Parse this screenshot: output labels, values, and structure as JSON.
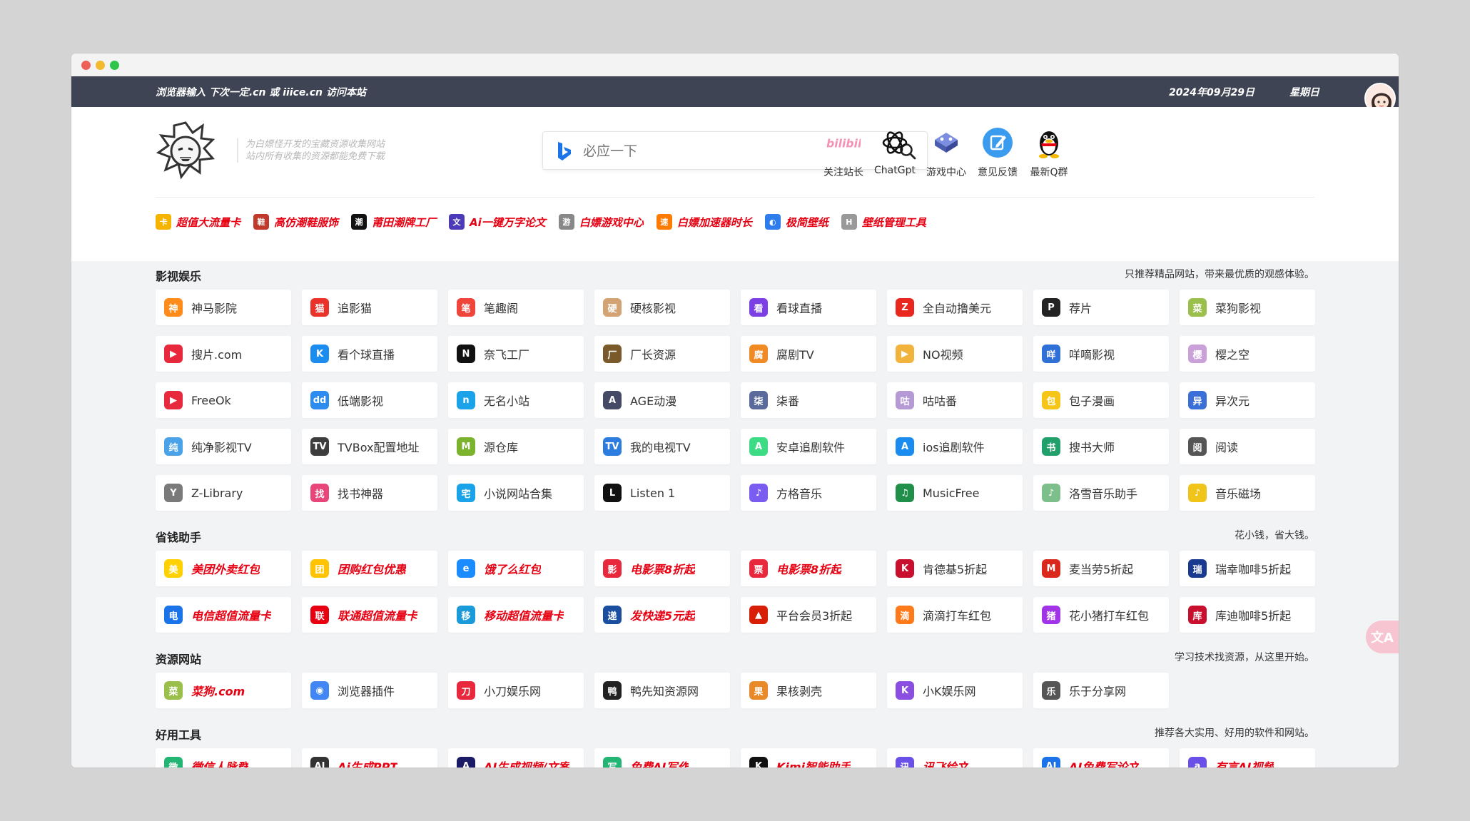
{
  "topbar": {
    "notice": "浏览器输入 下次一定.cn 或 iiice.cn 访问本站",
    "date": "2024年09月29日",
    "weekday": "星期日"
  },
  "header": {
    "slogan_line1": "为白嫖怪开发的宝藏资源收集网站",
    "slogan_line2": "站内所有收集的资源都能免费下载",
    "search_placeholder": "必应一下",
    "quick_links": [
      {
        "label": "关注站长",
        "icon": "bilibili-icon",
        "color": "#f492b5"
      },
      {
        "label": "ChatGpt",
        "icon": "openai-icon",
        "color": "#111111"
      },
      {
        "label": "游戏中心",
        "icon": "gamepad-icon",
        "color": "#5b6cb8"
      },
      {
        "label": "意见反馈",
        "icon": "feedback-icon",
        "color": "#3b9bef"
      },
      {
        "label": "最新Q群",
        "icon": "qq-penguin-icon",
        "color": "#111111"
      }
    ]
  },
  "ads": [
    {
      "label": "超值大流量卡",
      "color": "#f4b400",
      "glyph": "卡"
    },
    {
      "label": "高仿潮鞋服饰",
      "color": "#c0392b",
      "glyph": "鞋"
    },
    {
      "label": "莆田潮牌工厂",
      "color": "#111111",
      "glyph": "潮"
    },
    {
      "label": "Ai一键万字论文",
      "color": "#4b3bb8",
      "glyph": "文"
    },
    {
      "label": "白嫖游戏中心",
      "color": "#888888",
      "glyph": "游"
    },
    {
      "label": "白嫖加速器时长",
      "color": "#ff7a00",
      "glyph": "速"
    },
    {
      "label": "极简壁纸",
      "color": "#2f7ded",
      "glyph": "◐"
    },
    {
      "label": "壁纸管理工具",
      "color": "#999999",
      "glyph": "H"
    }
  ],
  "sections": [
    {
      "title": "影视娱乐",
      "desc": "只推荐精品网站，带来最优质的观感体验。",
      "items": [
        {
          "label": "神马影院",
          "color": "#ff8c1a",
          "glyph": "神"
        },
        {
          "label": "追影猫",
          "color": "#e8322a",
          "glyph": "猫"
        },
        {
          "label": "笔趣阁",
          "color": "#f0453a",
          "glyph": "笔"
        },
        {
          "label": "硬核影视",
          "color": "#d4a373",
          "glyph": "硬"
        },
        {
          "label": "看球直播",
          "color": "#7b3fe4",
          "glyph": "看"
        },
        {
          "label": "全自动撸美元",
          "color": "#e8281e",
          "glyph": "Z"
        },
        {
          "label": "荐片",
          "color": "#222222",
          "glyph": "P"
        },
        {
          "label": "菜狗影视",
          "color": "#9abf4a",
          "glyph": "菜"
        },
        {
          "label": "搜片.com",
          "color": "#e8283c",
          "glyph": "▶"
        },
        {
          "label": "看个球直播",
          "color": "#1b8cf0",
          "glyph": "K"
        },
        {
          "label": "奈飞工厂",
          "color": "#111111",
          "glyph": "N"
        },
        {
          "label": "厂长资源",
          "color": "#7a5a2a",
          "glyph": "厂"
        },
        {
          "label": "腐剧TV",
          "color": "#f08a24",
          "glyph": "腐"
        },
        {
          "label": "NO视频",
          "color": "#f2b33d",
          "glyph": "▶"
        },
        {
          "label": "咩嘀影视",
          "color": "#2e6fd8",
          "glyph": "咩"
        },
        {
          "label": "樱之空",
          "color": "#c9a0d8",
          "glyph": "樱"
        },
        {
          "label": "FreeOk",
          "color": "#e8283c",
          "glyph": "▶"
        },
        {
          "label": "低端影视",
          "color": "#2d8cf0",
          "glyph": "dd"
        },
        {
          "label": "无名小站",
          "color": "#1aa3e8",
          "glyph": "n"
        },
        {
          "label": "AGE动漫",
          "color": "#444a66",
          "glyph": "A"
        },
        {
          "label": "柒番",
          "color": "#5a6a9a",
          "glyph": "柒"
        },
        {
          "label": "咕咕番",
          "color": "#b59ad6",
          "glyph": "咕"
        },
        {
          "label": "包子漫画",
          "color": "#f5c518",
          "glyph": "包"
        },
        {
          "label": "异次元",
          "color": "#3a6fd8",
          "glyph": "异"
        },
        {
          "label": "纯净影视TV",
          "color": "#4aa3e8",
          "glyph": "纯"
        },
        {
          "label": "TVBox配置地址",
          "color": "#3d3d3d",
          "glyph": "TV"
        },
        {
          "label": "源仓库",
          "color": "#7bb32e",
          "glyph": "M"
        },
        {
          "label": "我的电视TV",
          "color": "#2d7de0",
          "glyph": "TV"
        },
        {
          "label": "安卓追剧软件",
          "color": "#3ddc84",
          "glyph": "A"
        },
        {
          "label": "ios追剧软件",
          "color": "#1a8cf0",
          "glyph": "A"
        },
        {
          "label": "搜书大师",
          "color": "#22a06b",
          "glyph": "书"
        },
        {
          "label": "阅读",
          "color": "#555555",
          "glyph": "阅"
        },
        {
          "label": "Z-Library",
          "color": "#7a7a7a",
          "glyph": "Y"
        },
        {
          "label": "找书神器",
          "color": "#e8457a",
          "glyph": "找"
        },
        {
          "label": "小说网站合集",
          "color": "#1aa3e8",
          "glyph": "宅"
        },
        {
          "label": "Listen 1",
          "color": "#111111",
          "glyph": "L"
        },
        {
          "label": "方格音乐",
          "color": "#7b5cf0",
          "glyph": "♪"
        },
        {
          "label": "MusicFree",
          "color": "#1f8f4a",
          "glyph": "♫"
        },
        {
          "label": "洛雪音乐助手",
          "color": "#7dbf8a",
          "glyph": "♪"
        },
        {
          "label": "音乐磁场",
          "color": "#f0c418",
          "glyph": "♪"
        }
      ]
    },
    {
      "title": "省钱助手",
      "desc": "花小钱，省大钱。",
      "items": [
        {
          "label": "美团外卖红包",
          "color": "#ffd100",
          "glyph": "美",
          "red": true
        },
        {
          "label": "团购红包优惠",
          "color": "#ffc300",
          "glyph": "团",
          "red": true
        },
        {
          "label": "饿了么红包",
          "color": "#1a8cff",
          "glyph": "e",
          "red": true
        },
        {
          "label": "电影票8折起",
          "color": "#e8283c",
          "glyph": "影",
          "red": true
        },
        {
          "label": "电影票8折起",
          "color": "#e8283c",
          "glyph": "票",
          "red": true
        },
        {
          "label": "肯德基5折起",
          "color": "#c8102e",
          "glyph": "K"
        },
        {
          "label": "麦当劳5折起",
          "color": "#da291c",
          "glyph": "M"
        },
        {
          "label": "瑞幸咖啡5折起",
          "color": "#1a3a8f",
          "glyph": "瑞"
        },
        {
          "label": "电信超值流量卡",
          "color": "#1a73e8",
          "glyph": "电",
          "red": true
        },
        {
          "label": "联通超值流量卡",
          "color": "#e60012",
          "glyph": "联",
          "red": true
        },
        {
          "label": "移动超值流量卡",
          "color": "#1a9ad8",
          "glyph": "移",
          "red": true
        },
        {
          "label": "发快递5元起",
          "color": "#1a4fa0",
          "glyph": "递",
          "red": true
        },
        {
          "label": "平台会员3折起",
          "color": "#d81e06",
          "glyph": "▲"
        },
        {
          "label": "滴滴打车红包",
          "color": "#ff7a1a",
          "glyph": "滴"
        },
        {
          "label": "花小猪打车红包",
          "color": "#a133e8",
          "glyph": "猪"
        },
        {
          "label": "库迪咖啡5折起",
          "color": "#c8102e",
          "glyph": "库"
        }
      ]
    },
    {
      "title": "资源网站",
      "desc": "学习技术找资源，从这里开始。",
      "items": [
        {
          "label": "菜狗.com",
          "color": "#9abf4a",
          "glyph": "菜",
          "red": true
        },
        {
          "label": "浏览器插件",
          "color": "#4285f4",
          "glyph": "◉"
        },
        {
          "label": "小刀娱乐网",
          "color": "#e8283c",
          "glyph": "刀"
        },
        {
          "label": "鸭先知资源网",
          "color": "#222222",
          "glyph": "鸭"
        },
        {
          "label": "果核剥壳",
          "color": "#e88a2a",
          "glyph": "果"
        },
        {
          "label": "小K娱乐网",
          "color": "#8a4fe0",
          "glyph": "K"
        },
        {
          "label": "乐于分享网",
          "color": "#555555",
          "glyph": "乐"
        }
      ]
    },
    {
      "title": "好用工具",
      "desc": "推荐各大实用、好用的软件和网站。",
      "items": [
        {
          "label": "微信人脉群",
          "color": "#22b573",
          "glyph": "微",
          "red": true
        },
        {
          "label": "Ai生成PPT",
          "color": "#333333",
          "glyph": "AI",
          "red": true
        },
        {
          "label": "AI生成视频/文案",
          "color": "#1a1a66",
          "glyph": "A",
          "red": true
        },
        {
          "label": "免费AI写作",
          "color": "#22b573",
          "glyph": "写",
          "red": true
        },
        {
          "label": "Kimi智能助手",
          "color": "#111111",
          "glyph": "K",
          "red": true
        },
        {
          "label": "讯飞绘文",
          "color": "#6a4fe8",
          "glyph": "讯",
          "red": true
        },
        {
          "label": "AI免费写论文",
          "color": "#1a73e8",
          "glyph": "AI",
          "red": true
        },
        {
          "label": "有言AI视频",
          "color": "#6a4fe8",
          "glyph": "a",
          "red": true
        }
      ]
    }
  ],
  "fab": {
    "label": "文A"
  }
}
